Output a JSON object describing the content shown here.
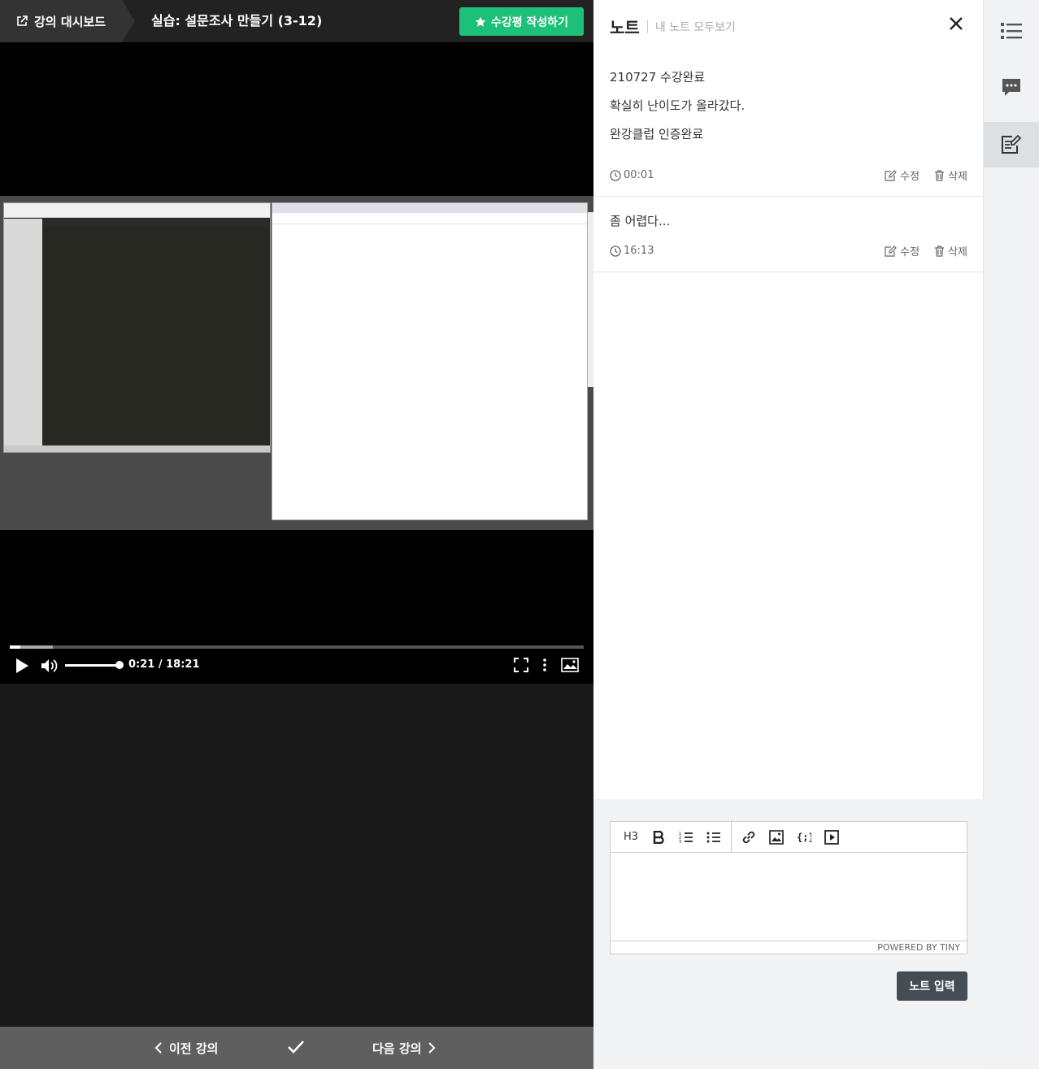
{
  "header": {
    "dashboard_label": "강의 대시보드",
    "lecture_title": "실습: 설문조사 만들기 (3-12)",
    "review_button": "수강평 작성하기"
  },
  "player": {
    "time": "0:21 / 18:21",
    "progress_fraction": 0.019,
    "buffered_fraction": 0.075,
    "volume_fraction": 0.93
  },
  "navigation": {
    "prev_label": "이전 강의",
    "next_label": "다음 강의"
  },
  "notes_panel": {
    "title": "노트",
    "view_all": "내 노트 모두보기",
    "notes": [
      {
        "lines": [
          "210727 수강완료",
          "확실히 난이도가 올라갔다.",
          "완강클럽 인증완료"
        ],
        "timestamp": "00:01",
        "edit_label": "수정",
        "delete_label": "삭제"
      },
      {
        "lines": [
          "좀 어렵다..."
        ],
        "timestamp": "16:13",
        "edit_label": "수정",
        "delete_label": "삭제"
      }
    ],
    "editor": {
      "toolbar_h3": "H3",
      "powered_by": "POWERED BY TINY",
      "submit_label": "노트 입력"
    }
  },
  "colors": {
    "accent_green": "#1dc078",
    "submit_bg": "#454d54"
  },
  "rail": {
    "items": [
      "list-icon",
      "chat-icon",
      "note-icon"
    ],
    "active": "note-icon"
  }
}
